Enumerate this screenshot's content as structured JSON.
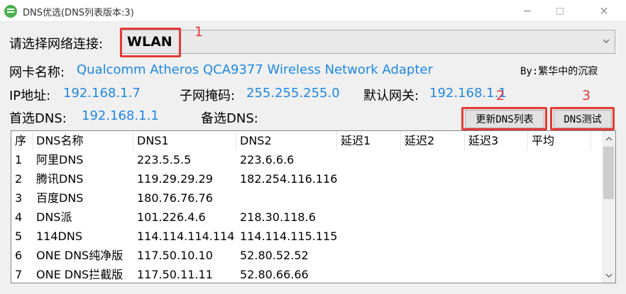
{
  "window": {
    "title": "DNS优选(DNS列表版本:3)",
    "close_glyph": "✕",
    "icon_color": "#4caf50"
  },
  "connection": {
    "label": "请选择网络连接:",
    "selected": "WLAN"
  },
  "adapter": {
    "label": "网卡名称:",
    "value": "Qualcomm Atheros QCA9377 Wireless Network Adapter"
  },
  "author": "By:繁华中的沉寂",
  "network": {
    "ip_label": "IP地址:",
    "ip_value": "192.168.1.7",
    "mask_label": "子网掩码:",
    "mask_value": "255.255.255.0",
    "gateway_label": "默认网关:",
    "gateway_value": "192.168.1.1",
    "primary_dns_label": "首选DNS:",
    "primary_dns_value": "192.168.1.1",
    "secondary_dns_label": "备选DNS:"
  },
  "buttons": {
    "update_list": "更新DNS列表",
    "dns_test": "DNS测试"
  },
  "annotations": {
    "mark1": "1",
    "mark2": "2",
    "mark3": "3",
    "color": "#e53935"
  },
  "table": {
    "headers": [
      "序",
      "DNS名称",
      "DNS1",
      "DNS2",
      "延迟1",
      "延迟2",
      "延迟3",
      "平均"
    ],
    "rows": [
      [
        "1",
        "阿里DNS",
        "223.5.5.5",
        "223.6.6.6",
        "",
        "",
        "",
        ""
      ],
      [
        "2",
        "腾讯DNS",
        "119.29.29.29",
        "182.254.116.116",
        "",
        "",
        "",
        ""
      ],
      [
        "3",
        "百度DNS",
        "180.76.76.76",
        "",
        "",
        "",
        "",
        ""
      ],
      [
        "4",
        "DNS派",
        "101.226.4.6",
        "218.30.118.6",
        "",
        "",
        "",
        ""
      ],
      [
        "5",
        "114DNS",
        "114.114.114.114",
        "114.114.115.115",
        "",
        "",
        "",
        ""
      ],
      [
        "6",
        "ONE DNS纯净版",
        "117.50.10.10",
        "52.80.52.52",
        "",
        "",
        "",
        ""
      ],
      [
        "7",
        "ONE DNS拦截版",
        "117.50.11.11",
        "52.80.66.66",
        "",
        "",
        "",
        ""
      ]
    ]
  },
  "colors": {
    "value_blue": "#1e88e5"
  }
}
